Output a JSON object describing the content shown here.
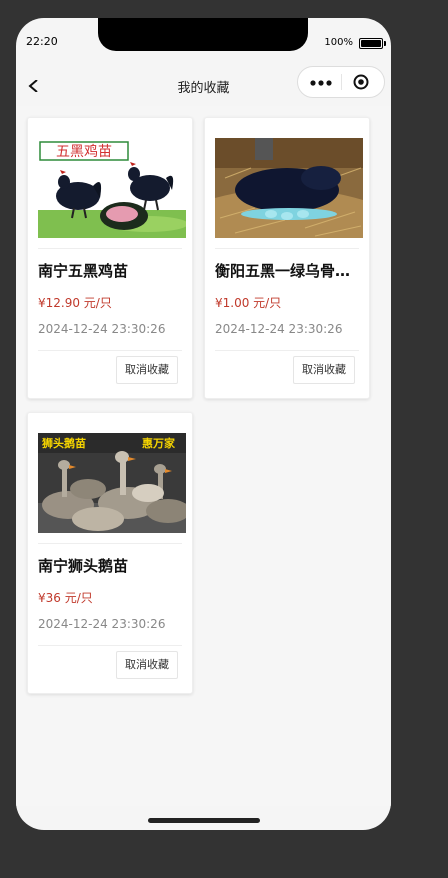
{
  "status": {
    "time": "22:20",
    "battery": "100%"
  },
  "nav": {
    "title": "我的收藏"
  },
  "favorites": [
    {
      "name": "南宁五黑鸡苗",
      "price": "¥12.90 元/只",
      "date": "2024-12-24 23:30:26",
      "cancel_label": "取消收藏",
      "image_caption": "五黑鸡苗"
    },
    {
      "name": "衡阳五黑一绿乌骨鸡苗",
      "price": "¥1.00 元/只",
      "date": "2024-12-24 23:30:26",
      "cancel_label": "取消收藏"
    },
    {
      "name": "南宁狮头鹅苗",
      "price": "¥36 元/只",
      "date": "2024-12-24 23:30:26",
      "cancel_label": "取消收藏",
      "image_caption_left": "狮头鹅苗",
      "image_caption_right": "惠万家"
    }
  ],
  "colors": {
    "price": "#c0392b",
    "background": "#333333",
    "page": "#f6f6f6"
  },
  "icons": {
    "back": "chevron-left-icon",
    "more": "more-dots-icon",
    "target": "target-icon",
    "battery": "battery-icon"
  }
}
